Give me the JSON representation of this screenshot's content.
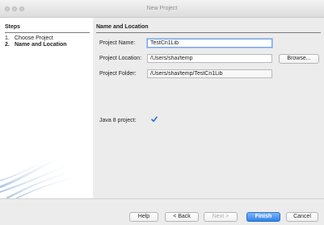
{
  "window": {
    "title": "New Project"
  },
  "steps": {
    "header": "Steps",
    "items": [
      {
        "num": "1.",
        "label": "Choose Project"
      },
      {
        "num": "2.",
        "label": "Name and Location"
      }
    ]
  },
  "content": {
    "header": "Name and Location",
    "project_name_label": "Project Name:",
    "project_name_value": "TestCn1Lib",
    "project_location_label": "Project Location:",
    "project_location_value": "/Users/shai/temp",
    "browse_label": "Browse...",
    "project_folder_label": "Project Folder:",
    "project_folder_value": "/Users/shai/temp/TestCn1Lib",
    "java8_label": "Java 8 project:",
    "java8_checked": true
  },
  "buttons": {
    "help": "Help",
    "back": "< Back",
    "next": "Next >",
    "finish": "Finish",
    "cancel": "Cancel"
  },
  "colors": {
    "accent": "#2f82ec",
    "checkmark": "#2a6fd6"
  }
}
